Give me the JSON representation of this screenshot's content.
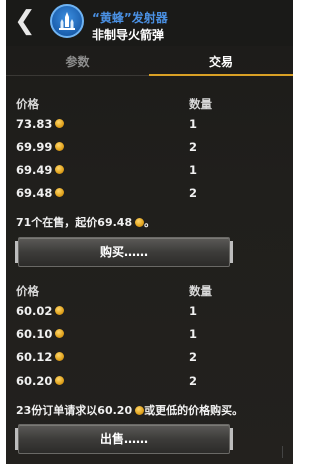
{
  "header": {
    "back_icon": "back-arrow-icon",
    "item_icon": "rocket-launcher-icon",
    "title": "“黄蜂”发射器",
    "subtitle": "非制导火箭弹"
  },
  "tabs": [
    {
      "label": "参数",
      "active": false
    },
    {
      "label": "交易",
      "active": true
    }
  ],
  "colors": {
    "accent": "#d9a025",
    "title": "#4a90e2",
    "background": "#1f1e1b"
  },
  "sell_listings": {
    "price_header": "价格",
    "quantity_header": "数量",
    "rows": [
      {
        "price": "73.83",
        "quantity": "1"
      },
      {
        "price": "69.99",
        "quantity": "2"
      },
      {
        "price": "69.49",
        "quantity": "1"
      },
      {
        "price": "69.48",
        "quantity": "2"
      }
    ],
    "summary_prefix": "71个在售，起价69.48",
    "summary_suffix": "。",
    "button_label": "购买……"
  },
  "buy_orders": {
    "price_header": "价格",
    "quantity_header": "数量",
    "rows": [
      {
        "price": "60.02",
        "quantity": "1"
      },
      {
        "price": "60.10",
        "quantity": "1"
      },
      {
        "price": "60.12",
        "quantity": "2"
      },
      {
        "price": "60.20",
        "quantity": "2"
      }
    ],
    "summary_prefix": "23份订单请求以60.20",
    "summary_suffix": "或更低的价格购买。",
    "button_label": "出售……"
  }
}
